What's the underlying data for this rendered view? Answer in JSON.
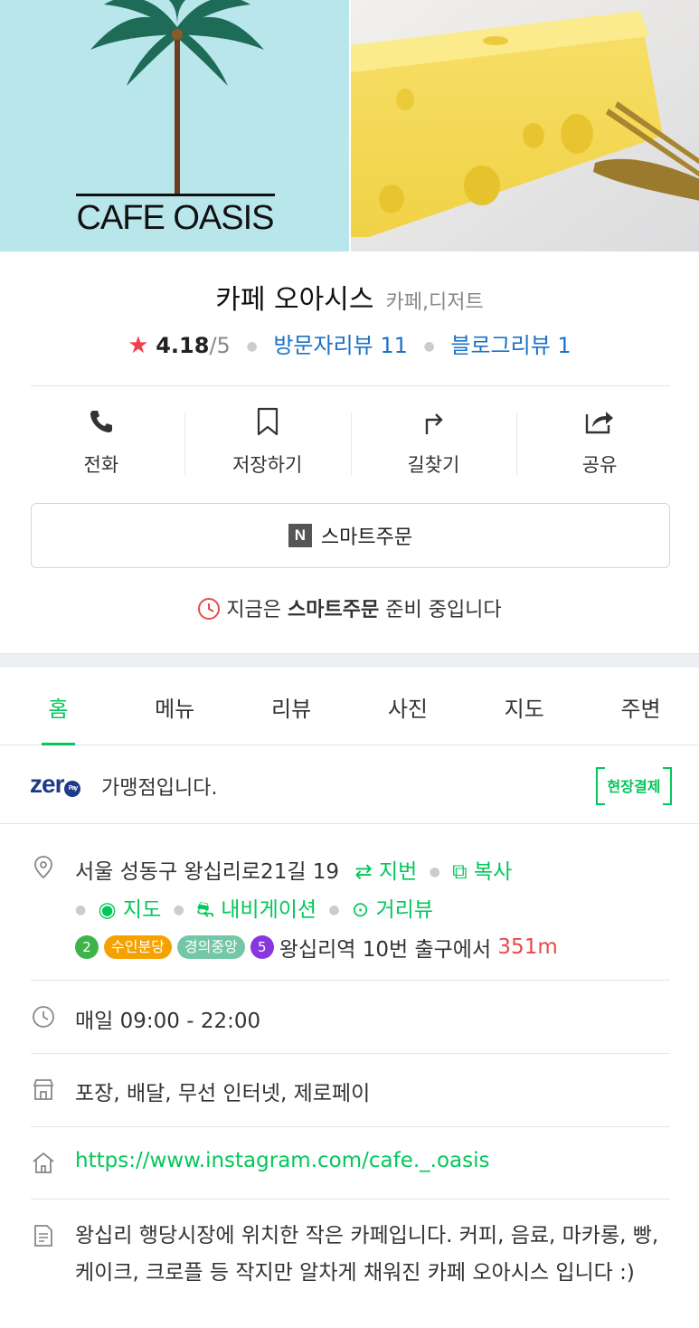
{
  "hero": {
    "logo_text": "CAFE OASIS"
  },
  "place": {
    "name": "카페 오아시스",
    "category": "카페,디저트",
    "rating": "4.18",
    "rating_max": "/5",
    "visitor_reviews": "방문자리뷰 11",
    "blog_reviews": "블로그리뷰 1"
  },
  "actions": [
    {
      "label": "전화",
      "icon": "phone-icon"
    },
    {
      "label": "저장하기",
      "icon": "bookmark-icon"
    },
    {
      "label": "길찾기",
      "icon": "directions-icon"
    },
    {
      "label": "공유",
      "icon": "share-icon"
    }
  ],
  "smart_order": {
    "badge": "N",
    "label": "스마트주문"
  },
  "notice": {
    "prefix": "지금은 ",
    "bold": "스마트주문",
    "suffix": " 준비 중입니다"
  },
  "tabs": [
    "홈",
    "메뉴",
    "리뷰",
    "사진",
    "지도",
    "주변"
  ],
  "active_tab": "홈",
  "zeropay": {
    "logo": "zer",
    "pay": "Pay",
    "text": "가맹점입니다.",
    "onsite_label": "현장결제"
  },
  "address": {
    "text": "서울 성동구 왕십리로21길 19",
    "lot_label": "지번",
    "copy_label": "복사",
    "map_label": "지도",
    "navi_label": "내비게이션",
    "street_label": "거리뷰"
  },
  "subway": {
    "line2": "2",
    "suin": "수인분당",
    "gyeongui": "경의중앙",
    "line5": "5",
    "station": "왕십리역",
    "exit_text": " 10번 출구에서 ",
    "distance": "351m"
  },
  "hours": "매일 09:00 - 22:00",
  "amenities": "포장, 배달, 무선 인터넷, 제로페이",
  "website": "https://www.instagram.com/cafe._.oasis",
  "description": "왕십리 행당시장에 위치한 작은 카페입니다. 커피, 음료, 마카롱, 빵, 케이크, 크로플 등 작지만 알차게 채워진 카페 오아시스 입니다 :)",
  "colors": {
    "accent_green": "#03c75a",
    "link_blue": "#1c72c6",
    "star_red": "#f1404b",
    "line2_green": "#3cb44a",
    "suin_yellow": "#f5a200",
    "gyeongui_teal": "#73c7a6",
    "line5_purple": "#8936e0"
  }
}
